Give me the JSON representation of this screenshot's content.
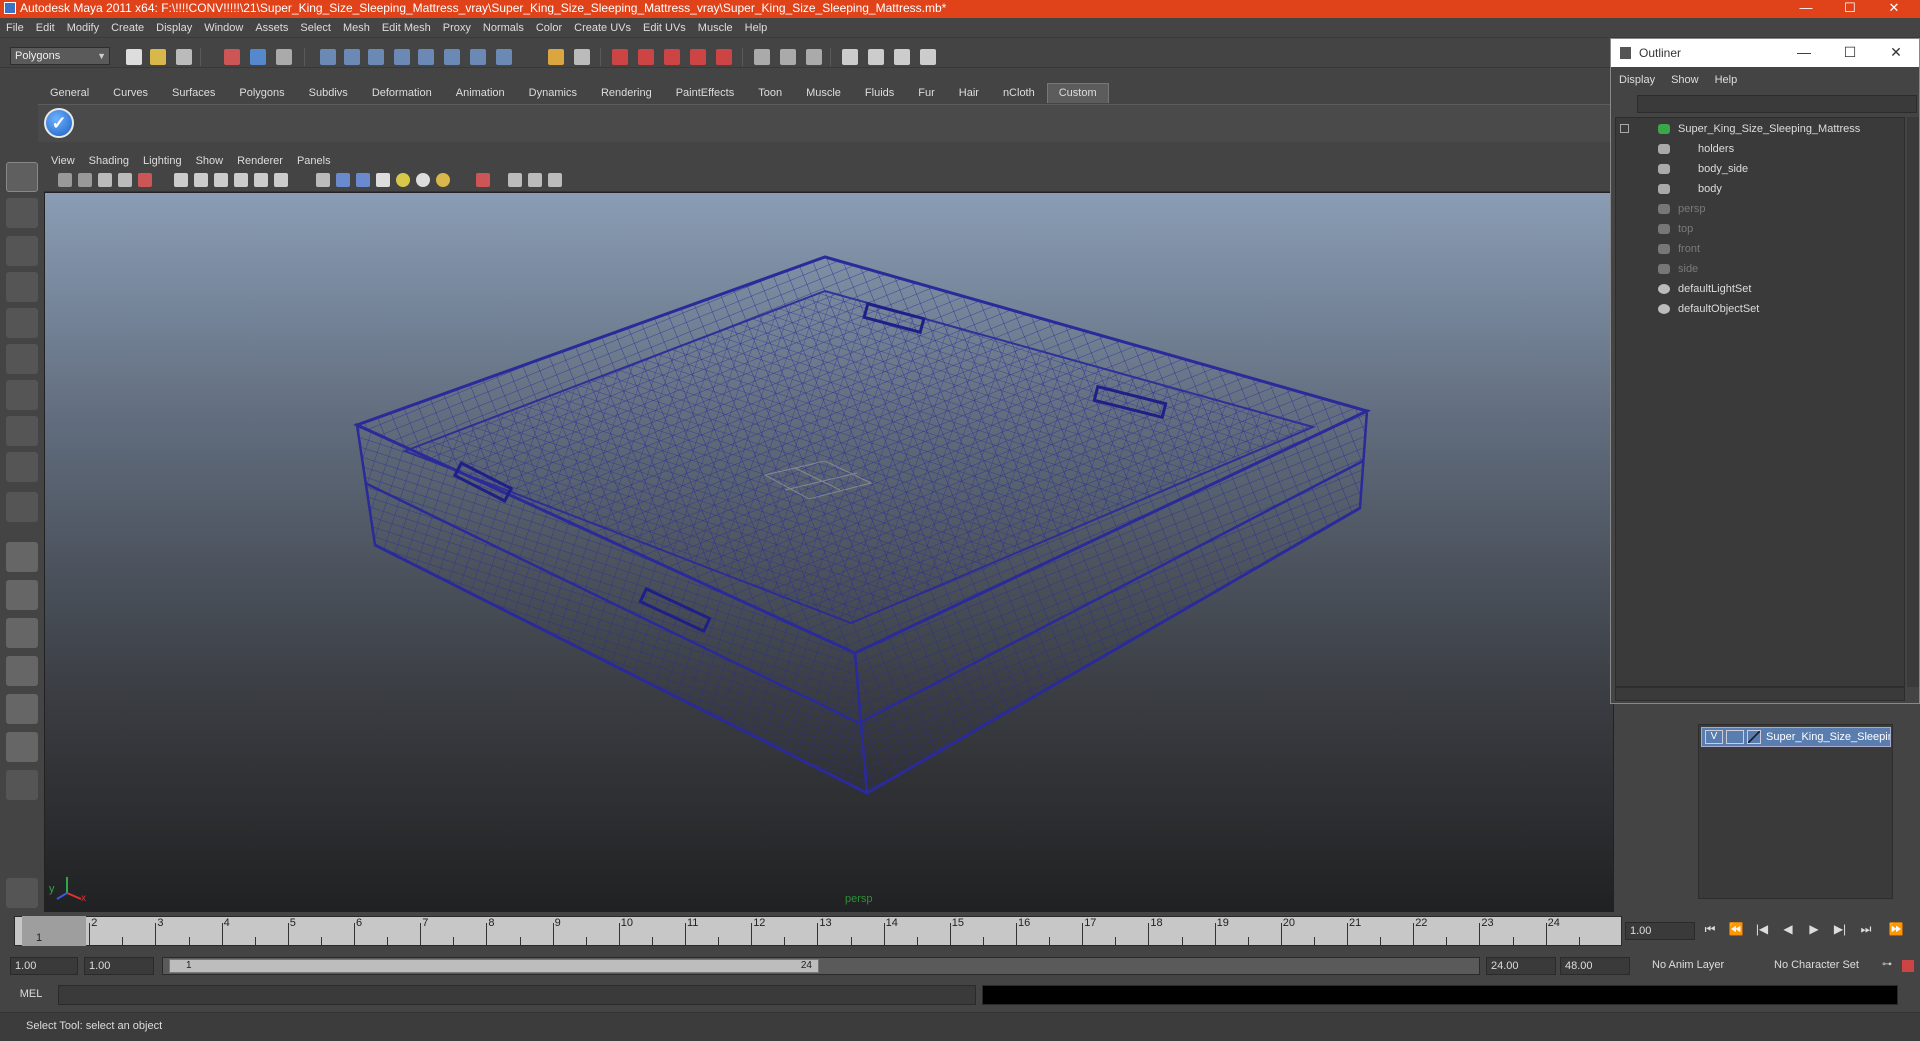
{
  "window": {
    "title": "Autodesk Maya 2011 x64: F:\\!!!!CONV!!!!!\\21\\Super_King_Size_Sleeping_Mattress_vray\\Super_King_Size_Sleeping_Mattress_vray\\Super_King_Size_Sleeping_Mattress.mb*",
    "min": "—",
    "max": "☐",
    "close": "✕"
  },
  "menubar": [
    "File",
    "Edit",
    "Modify",
    "Create",
    "Display",
    "Window",
    "Assets",
    "Select",
    "Mesh",
    "Edit Mesh",
    "Proxy",
    "Normals",
    "Color",
    "Create UVs",
    "Edit UVs",
    "Muscle",
    "Help"
  ],
  "toolbar": {
    "mode": "Polygons"
  },
  "shelf": {
    "tabs": [
      "General",
      "Curves",
      "Surfaces",
      "Polygons",
      "Subdivs",
      "Deformation",
      "Animation",
      "Dynamics",
      "Rendering",
      "PaintEffects",
      "Toon",
      "Muscle",
      "Fluids",
      "Fur",
      "Hair",
      "nCloth",
      "Custom"
    ],
    "active_tab": "Custom",
    "custom_icon": "checkmark-icon"
  },
  "viewport": {
    "menu": [
      "View",
      "Shading",
      "Lighting",
      "Show",
      "Renderer",
      "Panels"
    ],
    "camera": "persp",
    "axis_y": "y",
    "axis_x": "x",
    "wire_color": "#2a2a9a"
  },
  "outliner": {
    "title": "Outliner",
    "menu": [
      "Display",
      "Show",
      "Help"
    ],
    "items": [
      {
        "label": "Super_King_Size_Sleeping_Mattress",
        "dim": false,
        "indent": 0
      },
      {
        "label": "holders",
        "dim": false,
        "indent": 1
      },
      {
        "label": "body_side",
        "dim": false,
        "indent": 1
      },
      {
        "label": "body",
        "dim": false,
        "indent": 1
      },
      {
        "label": "persp",
        "dim": true,
        "indent": 0
      },
      {
        "label": "top",
        "dim": true,
        "indent": 0
      },
      {
        "label": "front",
        "dim": true,
        "indent": 0
      },
      {
        "label": "side",
        "dim": true,
        "indent": 0
      },
      {
        "label": "defaultLightSet",
        "dim": false,
        "indent": 0
      },
      {
        "label": "defaultObjectSet",
        "dim": false,
        "indent": 0
      }
    ]
  },
  "layers": {
    "row": {
      "visible": "V",
      "name": "Super_King_Size_Sleeping_Mattress"
    }
  },
  "timeline": {
    "ticks": [
      "1",
      "2",
      "3",
      "4",
      "5",
      "6",
      "7",
      "8",
      "9",
      "10",
      "11",
      "12",
      "13",
      "14",
      "15",
      "16",
      "17",
      "18",
      "19",
      "20",
      "21",
      "22",
      "23",
      "24"
    ],
    "current": "1",
    "current_time_field": "1.00",
    "playback": [
      "⏮",
      "⏪",
      "|◀",
      "◀",
      "▶",
      "▶|",
      "⏭",
      "⏩"
    ]
  },
  "range": {
    "start": "1.00",
    "start2": "1.00",
    "slider_start": "1",
    "slider_end": "24",
    "end": "24.00",
    "end2": "48.00",
    "anim_layer": "No Anim Layer",
    "char_set": "No Character Set"
  },
  "command": {
    "lang": "MEL"
  },
  "status": "Select Tool: select an object"
}
